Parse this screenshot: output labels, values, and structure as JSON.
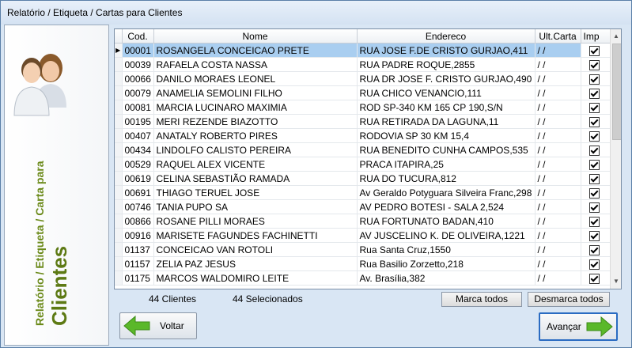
{
  "window": {
    "title": "Relatório / Etiqueta / Cartas para Clientes"
  },
  "side": {
    "subtitle": "Relatório / Etiqueta / Carta para",
    "title": "Clientes"
  },
  "grid": {
    "columns": [
      "Cod.",
      "Nome",
      "Endereco",
      "Ult.Carta",
      "Imp"
    ],
    "rows": [
      {
        "cod": "00001",
        "nome": "ROSANGELA CONCEICAO PRETE",
        "end": "RUA JOSE F.DE CRISTO GURJAO,411",
        "ult": "/ /",
        "imp": true
      },
      {
        "cod": "00039",
        "nome": "RAFAELA COSTA NASSA",
        "end": "RUA PADRE ROQUE,2855",
        "ult": "/ /",
        "imp": true
      },
      {
        "cod": "00066",
        "nome": "DANILO MORAES LEONEL",
        "end": "RUA DR JOSE F. CRISTO GURJAO,490",
        "ult": "/ /",
        "imp": true
      },
      {
        "cod": "00079",
        "nome": "ANAMELIA SEMOLINI FILHO",
        "end": "RUA CHICO VENANCIO,111",
        "ult": "/ /",
        "imp": true
      },
      {
        "cod": "00081",
        "nome": "MARCIA LUCINARO MAXIMIA",
        "end": "ROD SP-340 KM 165  CP 190,S/N",
        "ult": "/ /",
        "imp": true
      },
      {
        "cod": "00195",
        "nome": "MERI REZENDE BIAZOTTO",
        "end": "RUA RETIRADA DA LAGUNA,11",
        "ult": "/ /",
        "imp": true
      },
      {
        "cod": "00407",
        "nome": "ANATALY ROBERTO PIRES",
        "end": "RODOVIA SP 30 KM 15,4",
        "ult": "/ /",
        "imp": true
      },
      {
        "cod": "00434",
        "nome": "LINDOLFO CALISTO PEREIRA",
        "end": "RUA BENEDITO CUNHA CAMPOS,535",
        "ult": "/ /",
        "imp": true
      },
      {
        "cod": "00529",
        "nome": "RAQUEL ALEX VICENTE",
        "end": "PRACA ITAPIRA,25",
        "ult": "/ /",
        "imp": true
      },
      {
        "cod": "00619",
        "nome": "CELINA SEBASTIÃO RAMADA",
        "end": "RUA DO TUCURA,812",
        "ult": "/ /",
        "imp": true
      },
      {
        "cod": "00691",
        "nome": "THIAGO TERUEL JOSE",
        "end": "Av Geraldo Potyguara Silveira Franc,298",
        "ult": "/ /",
        "imp": true
      },
      {
        "cod": "00746",
        "nome": "TANIA PUPO SA",
        "end": "AV PEDRO BOTESI - SALA 2,524",
        "ult": "/ /",
        "imp": true
      },
      {
        "cod": "00866",
        "nome": "ROSANE PILLI MORAES",
        "end": "RUA FORTUNATO BADAN,410",
        "ult": "/ /",
        "imp": true
      },
      {
        "cod": "00916",
        "nome": "MARISETE FAGUNDES FACHINETTI",
        "end": "AV JUSCELINO K. DE OLIVEIRA,1221",
        "ult": "/ /",
        "imp": true
      },
      {
        "cod": "01137",
        "nome": "CONCEICAO VAN ROTOLI",
        "end": "Rua Santa Cruz,1550",
        "ult": "/ /",
        "imp": true
      },
      {
        "cod": "01157",
        "nome": "ZELIA PAZ JESUS",
        "end": "Rua Basilio Zorzetto,218",
        "ult": "/ /",
        "imp": true
      },
      {
        "cod": "01175",
        "nome": "MARCOS WALDOMIRO LEITE",
        "end": "Av. Brasília,382",
        "ult": "/ /",
        "imp": true
      }
    ]
  },
  "footer": {
    "clientes": "44 Clientes",
    "selecionados": "44 Selecionados",
    "marca_todos": "Marca todos",
    "desmarca_todos": "Desmarca todos",
    "voltar": "Voltar",
    "avancar": "Avançar"
  },
  "colors": {
    "selected_row": "#a9cef0",
    "side_text": "#6b8a1a",
    "arrow_green": "#5ab82a"
  }
}
